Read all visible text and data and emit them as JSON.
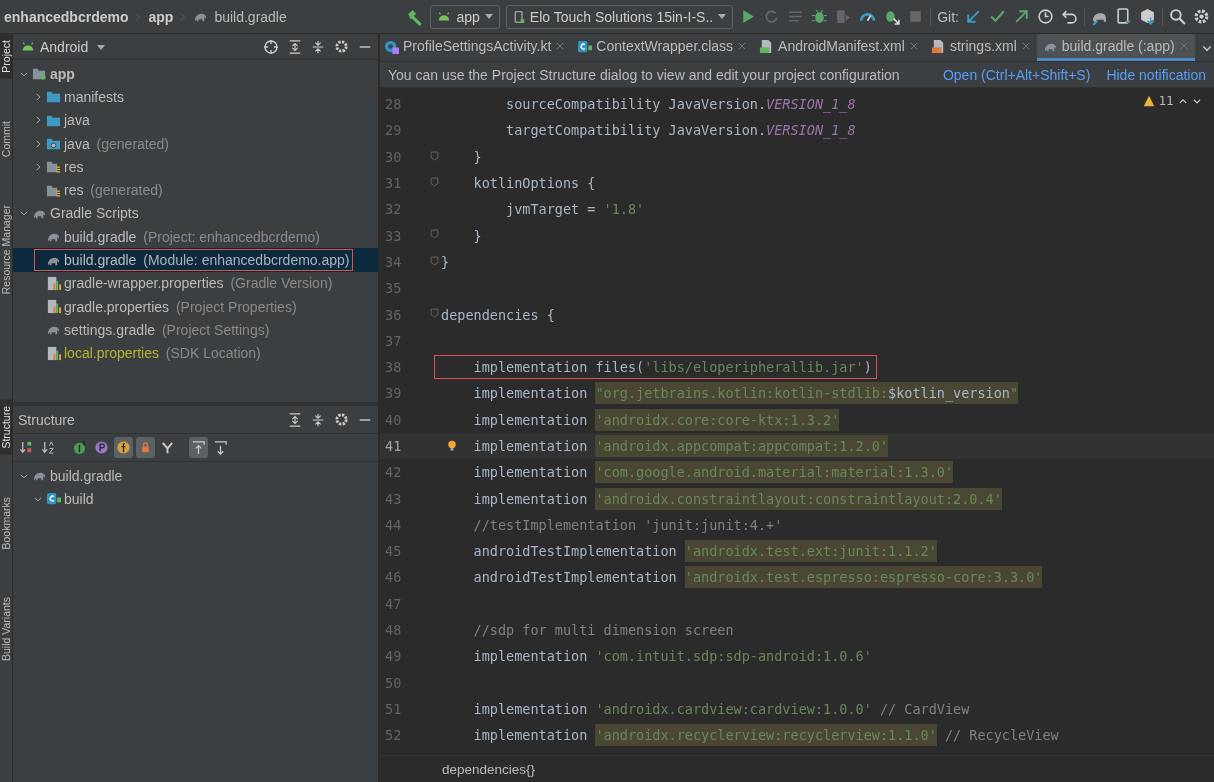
{
  "breadcrumb": {
    "project": "enhancedbcrdemo",
    "module": "app",
    "file": "build.gradle"
  },
  "toolbar": {
    "config": "app",
    "device": "Elo Touch Solutions 15in-I-S..",
    "vcs_label": "Git:"
  },
  "tool_strip": {
    "top": [
      {
        "label": "Project",
        "selected": true
      },
      {
        "label": "Commit",
        "selected": false
      },
      {
        "label": "Resource Manager",
        "selected": false
      }
    ],
    "bottom": [
      {
        "label": "Structure",
        "selected": true
      },
      {
        "label": "Bookmarks",
        "selected": false
      },
      {
        "label": "Build Variants",
        "selected": false
      }
    ]
  },
  "project_panel": {
    "view": "Android",
    "tree": [
      {
        "label": "app",
        "kind": "module",
        "expanded": true,
        "selected": false,
        "outlined": false,
        "ignored": false,
        "children": [
          {
            "label": "manifests",
            "kind": "folder",
            "expanded": false,
            "selected": false,
            "outlined": false,
            "ignored": false
          },
          {
            "label": "java",
            "kind": "folder",
            "expanded": false,
            "selected": false,
            "outlined": false,
            "ignored": false
          },
          {
            "label": "java",
            "hint": "(generated)",
            "kind": "generated-folder",
            "expanded": false,
            "selected": false,
            "outlined": false,
            "ignored": false
          },
          {
            "label": "res",
            "kind": "resources",
            "expanded": false,
            "selected": false,
            "outlined": false,
            "ignored": false
          },
          {
            "label": "res",
            "hint": "(generated)",
            "kind": "resources",
            "selected": false,
            "outlined": false,
            "ignored": false
          }
        ]
      },
      {
        "label": "Gradle Scripts",
        "kind": "gradle",
        "expanded": true,
        "selected": false,
        "outlined": false,
        "ignored": false,
        "children": [
          {
            "label": "build.gradle",
            "hint": "(Project: enhancedbcrdemo)",
            "kind": "gradle",
            "selected": false,
            "outlined": false,
            "ignored": false
          },
          {
            "label": "build.gradle",
            "hint": "(Module: enhancedbcrdemo.app)",
            "kind": "gradle",
            "selected": true,
            "outlined": true,
            "ignored": false
          },
          {
            "label": "gradle-wrapper.properties",
            "hint": "(Gradle Version)",
            "kind": "properties",
            "selected": false,
            "outlined": false,
            "ignored": false
          },
          {
            "label": "gradle.properties",
            "hint": "(Project Properties)",
            "kind": "properties",
            "selected": false,
            "outlined": false,
            "ignored": false
          },
          {
            "label": "settings.gradle",
            "hint": "(Project Settings)",
            "kind": "gradle",
            "selected": false,
            "outlined": false,
            "ignored": false
          },
          {
            "label": "local.properties",
            "hint": "(SDK Location)",
            "kind": "properties",
            "selected": false,
            "outlined": false,
            "ignored": true
          }
        ]
      }
    ]
  },
  "structure_panel": {
    "title": "Structure",
    "tools": [
      {
        "kind": "sort-visibility",
        "on": false
      },
      {
        "kind": "sort-alpha",
        "on": false
      },
      {
        "kind": "inherited",
        "on": false
      },
      {
        "kind": "properties",
        "on": false
      },
      {
        "kind": "fields",
        "on": true
      },
      {
        "kind": "non-public",
        "on": true
      },
      {
        "kind": "lambdas",
        "on": false
      },
      {
        "kind": "autoscroll-to",
        "on": true
      },
      {
        "kind": "autoscroll-from",
        "on": false
      }
    ],
    "tree": [
      {
        "label": "build.gradle",
        "kind": "gradle",
        "expanded": true,
        "children": [
          {
            "label": "build",
            "kind": "class",
            "expanded": true
          }
        ]
      }
    ]
  },
  "editor": {
    "tabs": [
      {
        "label": "ProfileSettingsActivity.kt",
        "kind": "kotlin",
        "selected": false
      },
      {
        "label": "ContextWrapper.class",
        "kind": "class",
        "selected": false
      },
      {
        "label": "AndroidManifest.xml",
        "kind": "manifest",
        "selected": false
      },
      {
        "label": "strings.xml",
        "kind": "xml",
        "selected": false
      },
      {
        "label": "build.gradle (:app)",
        "kind": "gradle",
        "selected": true
      }
    ],
    "notification": {
      "text": "You can use the Project Structure dialog to view and edit your project configuration",
      "actions": [
        "Open (Ctrl+Alt+Shift+S)",
        "Hide notification"
      ]
    },
    "warnings": "11",
    "lines": [
      {
        "number": "28",
        "fold": false,
        "current": false,
        "bulb": false,
        "outlined": false,
        "segments": [
          {
            "kind": "text",
            "text": "        sourceCompatibility JavaVersion."
          },
          {
            "kind": "const",
            "text": "VERSION_1_8"
          }
        ]
      },
      {
        "number": "29",
        "fold": false,
        "current": false,
        "bulb": false,
        "outlined": false,
        "segments": [
          {
            "kind": "text",
            "text": "        targetCompatibility JavaVersion."
          },
          {
            "kind": "const",
            "text": "VERSION_1_8"
          }
        ]
      },
      {
        "number": "30",
        "fold": true,
        "current": false,
        "bulb": false,
        "outlined": false,
        "segments": [
          {
            "kind": "text",
            "text": "    }"
          }
        ]
      },
      {
        "number": "31",
        "fold": true,
        "current": false,
        "bulb": false,
        "outlined": false,
        "segments": [
          {
            "kind": "text",
            "text": "    kotlinOptions {"
          }
        ]
      },
      {
        "number": "32",
        "fold": false,
        "current": false,
        "bulb": false,
        "outlined": false,
        "segments": [
          {
            "kind": "text",
            "text": "        jvmTarget = "
          },
          {
            "kind": "string",
            "text": "'1.8'"
          }
        ]
      },
      {
        "number": "33",
        "fold": true,
        "current": false,
        "bulb": false,
        "outlined": false,
        "segments": [
          {
            "kind": "text",
            "text": "    }"
          }
        ]
      },
      {
        "number": "34",
        "fold": true,
        "current": false,
        "bulb": false,
        "outlined": false,
        "segments": [
          {
            "kind": "text",
            "text": "}"
          }
        ]
      },
      {
        "number": "35",
        "fold": false,
        "current": false,
        "bulb": false
      },
      {
        "number": "36",
        "fold": true,
        "current": false,
        "bulb": false,
        "outlined": false,
        "segments": [
          {
            "kind": "text",
            "text": "dependencies {"
          }
        ]
      },
      {
        "number": "37",
        "fold": false,
        "current": false,
        "bulb": false
      },
      {
        "number": "38",
        "fold": false,
        "current": false,
        "bulb": false,
        "outlined": true,
        "segments": [
          {
            "kind": "text",
            "text": "implementation files("
          },
          {
            "kind": "string",
            "text": "'libs/eloperipherallib.jar'"
          },
          {
            "kind": "text",
            "text": ")"
          }
        ]
      },
      {
        "number": "39",
        "fold": false,
        "current": false,
        "bulb": false,
        "outlined": false,
        "segments": [
          {
            "kind": "text",
            "text": "implementation "
          },
          {
            "kind": "string-hl",
            "text": "\"org.jetbrains.kotlin:kotlin-stdlib:"
          },
          {
            "kind": "text-hl",
            "text": "$kotlin_version"
          },
          {
            "kind": "string-hl",
            "text": "\""
          }
        ]
      },
      {
        "number": "40",
        "fold": false,
        "current": false,
        "bulb": false,
        "outlined": false,
        "segments": [
          {
            "kind": "text",
            "text": "implementation "
          },
          {
            "kind": "string-hl",
            "text": "'androidx.core:core-ktx:1.3.2'"
          }
        ]
      },
      {
        "number": "41",
        "fold": false,
        "current": true,
        "bulb": true,
        "outlined": false,
        "segments": [
          {
            "kind": "text",
            "text": "implementation "
          },
          {
            "kind": "string-hl",
            "text": "'androidx.appcompat:appcompat:1.2.0'"
          }
        ]
      },
      {
        "number": "42",
        "fold": false,
        "current": false,
        "bulb": false,
        "outlined": false,
        "segments": [
          {
            "kind": "text",
            "text": "implementation "
          },
          {
            "kind": "string-hl",
            "text": "'com.google.android.material:material:1.3.0'"
          }
        ]
      },
      {
        "number": "43",
        "fold": false,
        "current": false,
        "bulb": false,
        "outlined": false,
        "segments": [
          {
            "kind": "text",
            "text": "implementation "
          },
          {
            "kind": "string-hl",
            "text": "'androidx.constraintlayout:constraintlayout:2.0.4'"
          }
        ]
      },
      {
        "number": "44",
        "fold": false,
        "current": false,
        "bulb": false,
        "outlined": false,
        "segments": [
          {
            "kind": "comment",
            "text": "//testImplementation 'junit:junit:4.+'"
          }
        ]
      },
      {
        "number": "45",
        "fold": false,
        "current": false,
        "bulb": false,
        "outlined": false,
        "segments": [
          {
            "kind": "text",
            "text": "androidTestImplementation "
          },
          {
            "kind": "string-hl",
            "text": "'androidx.test.ext:junit:1.1.2'"
          }
        ]
      },
      {
        "number": "46",
        "fold": false,
        "current": false,
        "bulb": false,
        "outlined": false,
        "segments": [
          {
            "kind": "text",
            "text": "androidTestImplementation "
          },
          {
            "kind": "string-hl",
            "text": "'androidx.test.espresso:espresso-core:3.3.0'"
          }
        ]
      },
      {
        "number": "47",
        "fold": false,
        "current": false,
        "bulb": false
      },
      {
        "number": "48",
        "fold": false,
        "current": false,
        "bulb": false,
        "outlined": false,
        "segments": [
          {
            "kind": "comment",
            "text": "//sdp for multi dimension screen"
          }
        ]
      },
      {
        "number": "49",
        "fold": false,
        "current": false,
        "bulb": false,
        "outlined": false,
        "segments": [
          {
            "kind": "text",
            "text": "implementation "
          },
          {
            "kind": "string",
            "text": "'com.intuit.sdp:sdp-android:1.0.6'"
          }
        ]
      },
      {
        "number": "50",
        "fold": false,
        "current": false,
        "bulb": false
      },
      {
        "number": "51",
        "fold": false,
        "current": false,
        "bulb": false,
        "outlined": false,
        "segments": [
          {
            "kind": "text",
            "text": "implementation "
          },
          {
            "kind": "string",
            "text": "'androidx.cardview:cardview:1.0.0'"
          },
          {
            "kind": "comment",
            "text": " // CardView"
          }
        ]
      },
      {
        "number": "52",
        "fold": false,
        "current": false,
        "bulb": false,
        "outlined": false,
        "segments": [
          {
            "kind": "text",
            "text": "implementation "
          },
          {
            "kind": "string-hl",
            "text": "'androidx.recyclerview:recyclerview:1.1.0'"
          },
          {
            "kind": "comment",
            "text": " // RecycleView"
          }
        ]
      }
    ],
    "breadcrumb": "dependencies{}"
  }
}
